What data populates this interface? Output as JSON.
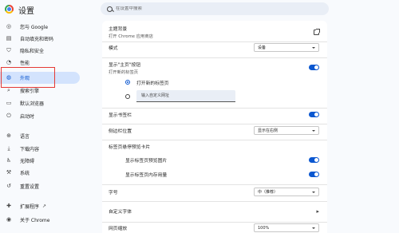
{
  "app": {
    "title": "设置"
  },
  "search": {
    "placeholder": "在设置中搜索"
  },
  "sidebar": {
    "items": [
      {
        "label": "您与 Google",
        "icon": "person-icon",
        "glyph": "◎"
      },
      {
        "label": "自动填充和密码",
        "icon": "autofill-icon",
        "glyph": "▤"
      },
      {
        "label": "隐私和安全",
        "icon": "shield-icon",
        "glyph": "⛉"
      },
      {
        "label": "性能",
        "icon": "speedometer-icon",
        "glyph": "◔"
      },
      {
        "label": "外观",
        "icon": "palette-icon",
        "glyph": "◍"
      },
      {
        "label": "搜索引擎",
        "icon": "search-icon",
        "glyph": "⌕"
      },
      {
        "label": "默认浏览器",
        "icon": "browser-icon",
        "glyph": "▭"
      },
      {
        "label": "启动时",
        "icon": "power-icon",
        "glyph": "⏻"
      },
      {
        "label": "语言",
        "icon": "language-icon",
        "glyph": "⊕"
      },
      {
        "label": "下载内容",
        "icon": "download-icon",
        "glyph": "⤓"
      },
      {
        "label": "无障碍",
        "icon": "accessibility-icon",
        "glyph": "♿"
      },
      {
        "label": "系统",
        "icon": "wrench-icon",
        "glyph": "⚒"
      },
      {
        "label": "重置设置",
        "icon": "reset-icon",
        "glyph": "↺"
      },
      {
        "label": "扩展程序",
        "icon": "extension-icon",
        "glyph": "✚"
      },
      {
        "label": "关于 Chrome",
        "icon": "chrome-icon",
        "glyph": "◉"
      }
    ],
    "active_index": 4
  },
  "main": {
    "theme": {
      "title": "主题背景",
      "subtitle": "打开 Chrome 应用商店"
    },
    "mode": {
      "label": "模式",
      "value": "设备"
    },
    "home_button": {
      "label": "显示\"主页\"按钮",
      "sublabel": "打开新的标签页",
      "enabled": true
    },
    "radio_new_tab": {
      "label": "打开新的标签页",
      "checked": true
    },
    "radio_custom": {
      "placeholder": "输入自定义网址",
      "checked": false
    },
    "bookmarks_bar": {
      "label": "显示书签栏",
      "enabled": true
    },
    "side_panel": {
      "label": "侧边栏位置",
      "value": "显示在右侧"
    },
    "tab_hover": {
      "label": "标签页悬停预览卡片"
    },
    "tab_preview_image": {
      "label": "显示标签页预览图片",
      "enabled": true
    },
    "tab_memory": {
      "label": "显示标签页内存用量",
      "enabled": true
    },
    "font_size": {
      "label": "字号",
      "value": "中（推荐）"
    },
    "custom_fonts": {
      "label": "自定义字体"
    },
    "page_zoom": {
      "label": "网页缩放",
      "value": "100%"
    }
  },
  "colors": {
    "accent": "#0b57d0",
    "active_bg": "#d3e3fd",
    "highlight_box": "#e53935"
  }
}
